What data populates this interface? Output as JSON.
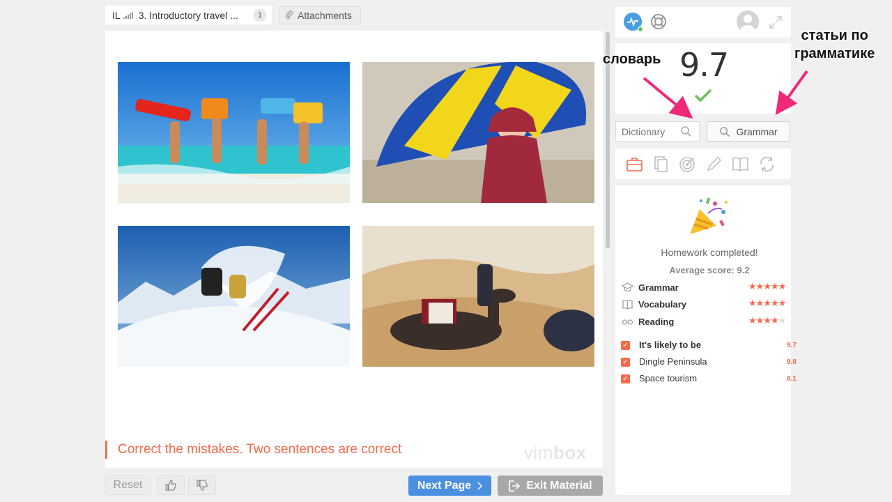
{
  "tabs": {
    "level": "IL",
    "lesson_title": "3. Introductory travel ...",
    "lesson_count": "1",
    "attachments_label": "Attachments"
  },
  "content": {
    "images": [
      {
        "alt": "beach-photo"
      },
      {
        "alt": "umbrella-girl-photo"
      },
      {
        "alt": "ski-photo"
      },
      {
        "alt": "desert-camel-photo"
      }
    ],
    "instruction": "Correct the mistakes. Two sentences are correct",
    "watermark_light": "vim",
    "watermark_bold": "box"
  },
  "footer": {
    "reset_label": "Reset",
    "next_label": "Next Page",
    "exit_label": "Exit Material"
  },
  "sidebar": {
    "score": "9.7",
    "dictionary_placeholder": "Dictionary",
    "grammar_label": "Grammar",
    "homework_status": "Homework completed!",
    "average_score": "Average score: 9.2",
    "skills": [
      {
        "label": "Grammar",
        "stars": 5,
        "icon": "graduation-cap-icon"
      },
      {
        "label": "Vocabulary",
        "stars": 5,
        "icon": "book-icon"
      },
      {
        "label": "Reading",
        "stars": 4,
        "icon": "glasses-icon"
      }
    ],
    "tasks": [
      {
        "label": "It's likely to be",
        "value": "9.7"
      },
      {
        "label": "Dingle Peninsula",
        "value": "9.8"
      },
      {
        "label": "Space tourism",
        "value": "8.1"
      }
    ]
  },
  "annotations": {
    "dictionary_note": "словарь",
    "grammar_note_line1": "статьи по",
    "grammar_note_line2": "грамматике"
  },
  "colors": {
    "accent": "#f36b4d",
    "primary_button": "#4a8fe0",
    "exit_button": "#a8a8a8",
    "annotation_arrow": "#f0287a"
  }
}
